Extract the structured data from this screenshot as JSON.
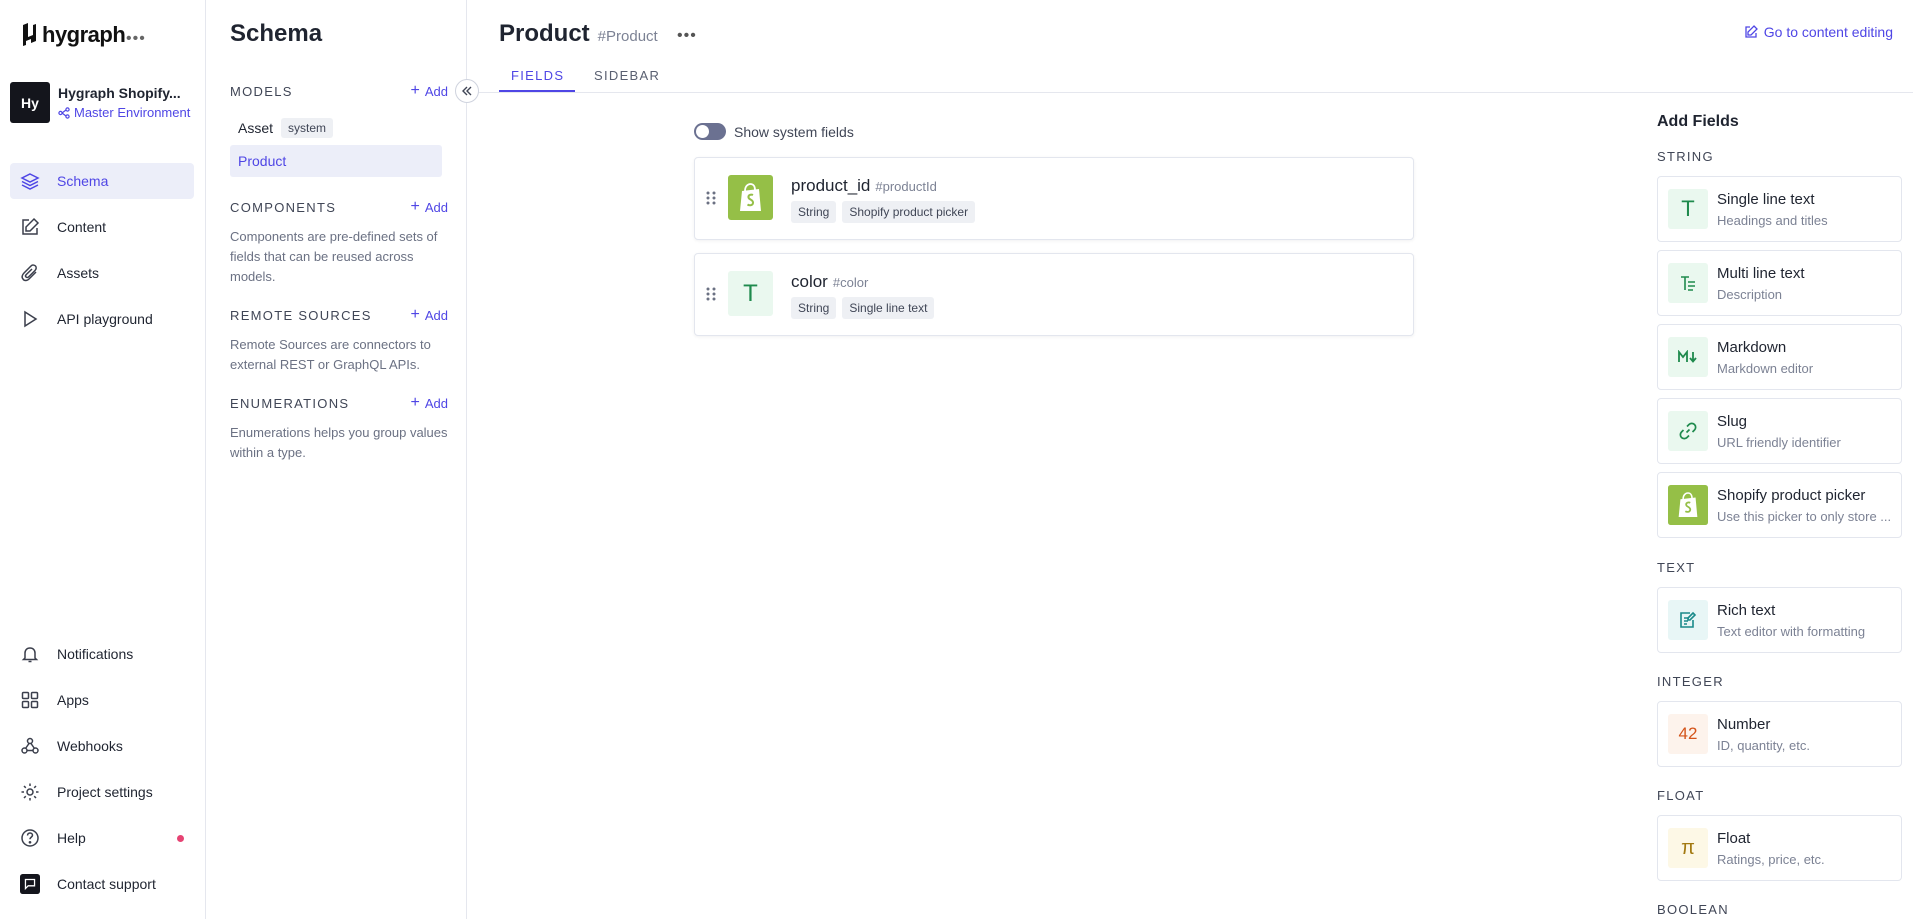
{
  "nav": {
    "logo": "hygraph",
    "project_name": "Hygraph Shopify...",
    "project_initials": "Hy",
    "environment": "Master Environment",
    "items": [
      {
        "label": "Schema"
      },
      {
        "label": "Content"
      },
      {
        "label": "Assets"
      },
      {
        "label": "API playground"
      }
    ],
    "bottom_items": [
      {
        "label": "Notifications"
      },
      {
        "label": "Apps"
      },
      {
        "label": "Webhooks"
      },
      {
        "label": "Project settings"
      },
      {
        "label": "Help"
      },
      {
        "label": "Contact support"
      }
    ]
  },
  "schema": {
    "title": "Schema",
    "models_label": "MODELS",
    "add_label": "Add",
    "models": [
      {
        "name": "Asset",
        "badge": "system"
      },
      {
        "name": "Product"
      }
    ],
    "components_label": "COMPONENTS",
    "components_desc": "Components are pre-defined sets of fields that can be reused across models.",
    "remote_label": "REMOTE SOURCES",
    "remote_desc": "Remote Sources are connectors to external REST or GraphQL APIs.",
    "enums_label": "ENUMERATIONS",
    "enums_desc": "Enumerations helps you group values within a type."
  },
  "main": {
    "title": "Product",
    "api_id": "#Product",
    "goto_label": "Go to content editing",
    "tabs": [
      {
        "label": "FIELDS"
      },
      {
        "label": "SIDEBAR"
      }
    ],
    "toggle_label": "Show system fields",
    "fields": [
      {
        "name": "product_id",
        "key": "#productId",
        "tags": [
          "String",
          "Shopify product picker"
        ],
        "icon": "shopify-icon"
      },
      {
        "name": "color",
        "key": "#color",
        "tags": [
          "String",
          "Single line text"
        ],
        "icon": "text-icon"
      }
    ]
  },
  "add_fields": {
    "title": "Add Fields",
    "sections": [
      {
        "label": "STRING"
      },
      {
        "label": "TEXT"
      },
      {
        "label": "INTEGER"
      },
      {
        "label": "FLOAT"
      },
      {
        "label": "BOOLEAN"
      }
    ],
    "cards": [
      {
        "name": "Single line text",
        "desc": "Headings and titles",
        "icon": "text-icon"
      },
      {
        "name": "Multi line text",
        "desc": "Description",
        "icon": "multiline-icon"
      },
      {
        "name": "Markdown",
        "desc": "Markdown editor",
        "icon": "markdown-icon"
      },
      {
        "name": "Slug",
        "desc": "URL friendly identifier",
        "icon": "link-icon"
      },
      {
        "name": "Shopify product picker",
        "desc": "Use this picker to only store ...",
        "icon": "shopify-icon"
      },
      {
        "name": "Rich text",
        "desc": "Text editor with formatting",
        "icon": "rich-text-icon"
      },
      {
        "name": "Number",
        "desc": "ID, quantity, etc.",
        "icon": "number-icon"
      },
      {
        "name": "Float",
        "desc": "Ratings, price, etc.",
        "icon": "pi-icon"
      }
    ],
    "number_glyph": "42",
    "pi_glyph": "π",
    "text_glyph": "T"
  },
  "colors": {
    "accent": "#4f46e5",
    "shopify_green": "#95bf47",
    "help_dot": "#e64373"
  }
}
